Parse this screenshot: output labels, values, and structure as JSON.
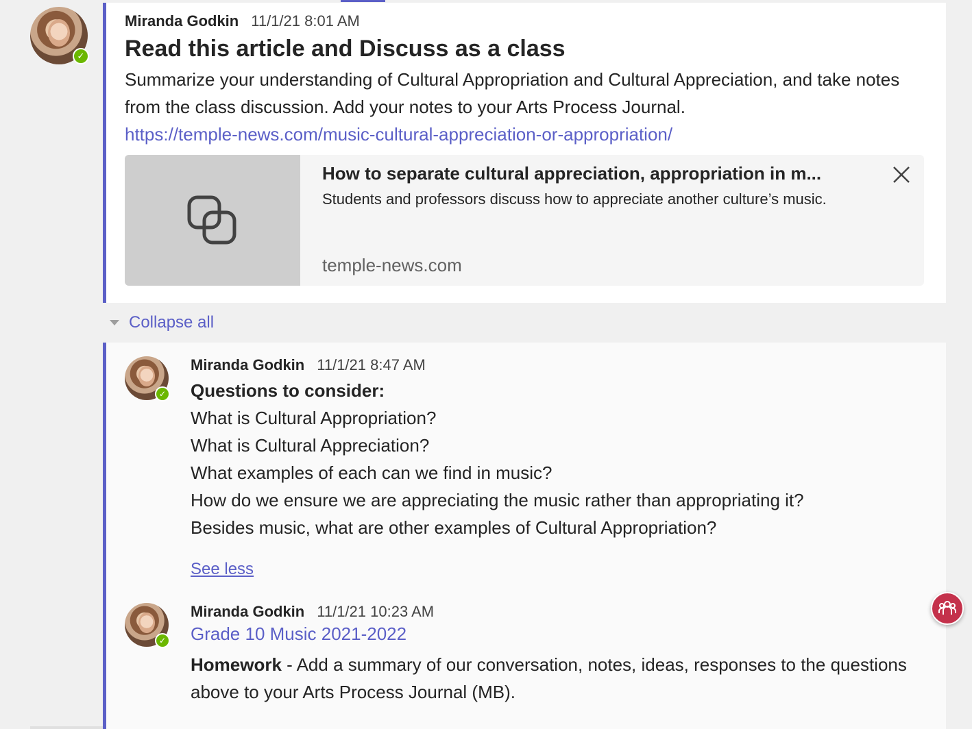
{
  "main_post": {
    "author": "Miranda Godkin",
    "timestamp": "11/1/21 8:01 AM",
    "title": "Read this article and Discuss as a class",
    "body": "Summarize your understanding of Cultural Appropriation and Cultural Appreciation, and take notes from the class discussion.  Add your notes to your Arts Process Journal.",
    "link": "https://temple-news.com/music-cultural-appreciation-or-appropriation/",
    "link_preview": {
      "title": "How to separate cultural appreciation, appropriation in m...",
      "description": "Students and professors discuss how to appreciate another culture’s music.",
      "domain": "temple-news.com",
      "icon": "link-icon"
    }
  },
  "collapse_all_label": "Collapse all",
  "replies": [
    {
      "author": "Miranda Godkin",
      "timestamp": "11/1/21 8:47 AM",
      "heading": "Questions to consider:",
      "lines": [
        "What is Cultural Appropriation?",
        "What is Cultural Appreciation?",
        "What examples of each can we find in music?",
        "How do we ensure we are appreciating the music rather than appropriating it?",
        "Besides music, what are other examples of Cultural Appropriation?"
      ],
      "see_less_label": "See less"
    },
    {
      "author": "Miranda Godkin",
      "timestamp": "11/1/21 10:23 AM",
      "channel_link": "Grade 10 Music 2021-2022",
      "homework_label": "Homework",
      "homework_text": " - Add a summary of our conversation, notes, ideas, responses to the questions above to your Arts Process Journal (MB)."
    }
  ],
  "colors": {
    "accent": "#5b5fc7",
    "presence_available": "#6bb700",
    "floating_button": "#c4314b"
  },
  "floating_button_icon": "people-icon"
}
